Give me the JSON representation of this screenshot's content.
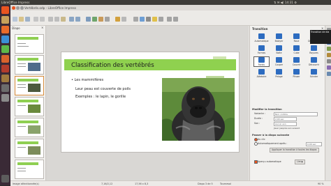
{
  "topbar": {
    "app_name": "LibreOffice Impress",
    "window_title": "Vertébrés.odp - LibreOffice Impress"
  },
  "slides_pane": {
    "header": "Diapo"
  },
  "slide": {
    "title": "Classification des vertébrés",
    "lines": [
      "Les mammifères",
      "Leur peau est couverte de poils",
      "Exemples : le lapin, le gorille"
    ]
  },
  "sidebar": {
    "title": "Transition",
    "transitions": [
      {
        "label": "Automatique",
        "icon": "transition-icon"
      },
      {
        "label": "Balayer",
        "icon": "transition-icon"
      },
      {
        "label": "Roue",
        "icon": "transition-icon"
      },
      {
        "label": "Découpure",
        "icon": "transition-icon"
      },
      {
        "label": "Formes",
        "icon": "transition-icon"
      },
      {
        "label": "Boîte",
        "icon": "transition-icon"
      },
      {
        "label": "Cube",
        "icon": "transition-icon"
      },
      {
        "label": "Rayures",
        "icon": "transition-icon"
      },
      {
        "label": "Fondu",
        "icon": "transition-icon"
      },
      {
        "label": "Couper",
        "icon": "transition-icon"
      },
      {
        "label": "Couvrir",
        "icon": "transition-icon"
      },
      {
        "label": "Découvrir",
        "icon": "transition-icon"
      },
      {
        "label": "Aléatoire",
        "icon": "transition-icon"
      },
      {
        "label": "Pelage",
        "icon": "transition-icon"
      },
      {
        "label": "Plisser",
        "icon": "transition-icon"
      },
      {
        "label": "Scinder",
        "icon": "transition-icon"
      }
    ],
    "modify_section": "Modifier la transition",
    "variante_label": "Variante :",
    "variante_value": "Noir continu",
    "duree_label": "Durée :",
    "duree_value": "2,00 sec",
    "son_label": "Son :",
    "son_value": "Aucun son",
    "loop_label": "Jouer jusqu'au son suivant",
    "advance_section": "Passer à la diapo suivante",
    "on_click_label": "Au clic",
    "auto_label": "Automatiquement après :",
    "auto_value": "0,00 sec",
    "apply_all_button": "Appliquer la transition à toutes les diapos",
    "autopreview_label": "Aperçu automatique",
    "play_button": "Lire",
    "play_button2": "▶"
  },
  "tooltip": {
    "text": "Transition de dia"
  },
  "statusbar": {
    "left": "Image sélectionnée(s)",
    "pos": "7,16/2,12",
    "size": "17,56 x 8,3",
    "slide": "Diapo 3 de 5",
    "layout": "Tournesol",
    "zoom": "90 %"
  },
  "colors": {
    "accent_green": "#8fd14f",
    "ubuntu_aubergine": "#3a2a36",
    "launcher_orange": "#e95420",
    "transition_blue": "#2d6cc0"
  }
}
